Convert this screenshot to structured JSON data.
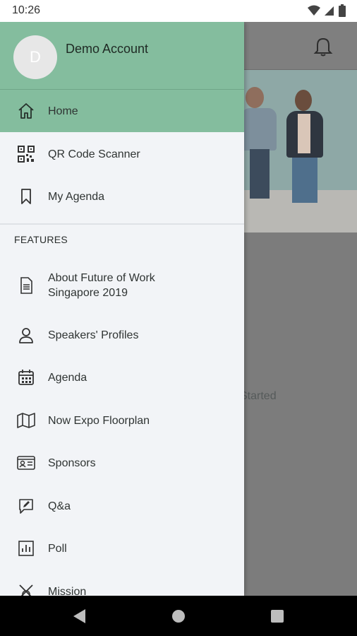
{
  "status_bar": {
    "time": "10:26"
  },
  "background": {
    "text": "Started"
  },
  "drawer": {
    "avatar_letter": "D",
    "account_name": "Demo Account",
    "top_items": [
      {
        "label": "Home",
        "icon": "home-icon",
        "active": true
      },
      {
        "label": "QR Code Scanner",
        "icon": "qr-code-icon"
      },
      {
        "label": "My Agenda",
        "icon": "bookmark-icon"
      }
    ],
    "section_title": "FEATURES",
    "feature_items": [
      {
        "label_line1": "About Future of Work",
        "label_line2": "Singapore 2019",
        "icon": "document-icon"
      },
      {
        "label": "Speakers' Profiles",
        "icon": "person-icon"
      },
      {
        "label": "Agenda",
        "icon": "calendar-icon"
      },
      {
        "label": "Now Expo Floorplan",
        "icon": "map-icon"
      },
      {
        "label": "Sponsors",
        "icon": "id-card-icon"
      },
      {
        "label": "Q&a",
        "icon": "chat-edit-icon"
      },
      {
        "label": "Poll",
        "icon": "poll-chart-icon"
      },
      {
        "label": "Mission",
        "icon": "mission-icon"
      }
    ]
  },
  "colors": {
    "accent": "#84bd9e",
    "drawer_bg": "#f2f4f7",
    "scrim": "#7c7c7c"
  }
}
